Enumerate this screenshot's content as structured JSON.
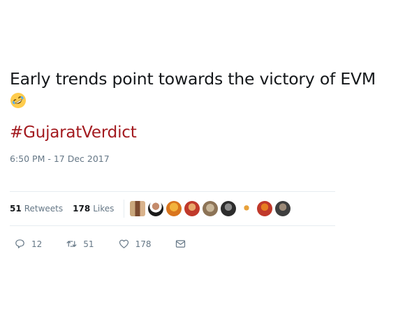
{
  "tweet": {
    "text": "Early trends point towards the victory of EVM",
    "emoji": "rolling-on-the-floor-laughing",
    "hashtag": "#GujaratVerdict",
    "timestamp": "6:50 PM - 17 Dec 2017"
  },
  "stats": {
    "retweets_count": "51",
    "retweets_label": "Retweets",
    "likes_count": "178",
    "likes_label": "Likes"
  },
  "actions": {
    "reply_count": "12",
    "retweet_count": "51",
    "like_count": "178"
  },
  "colors": {
    "hashtag": "#a31a1f",
    "muted": "#657786",
    "divider": "#e6ecf0"
  }
}
